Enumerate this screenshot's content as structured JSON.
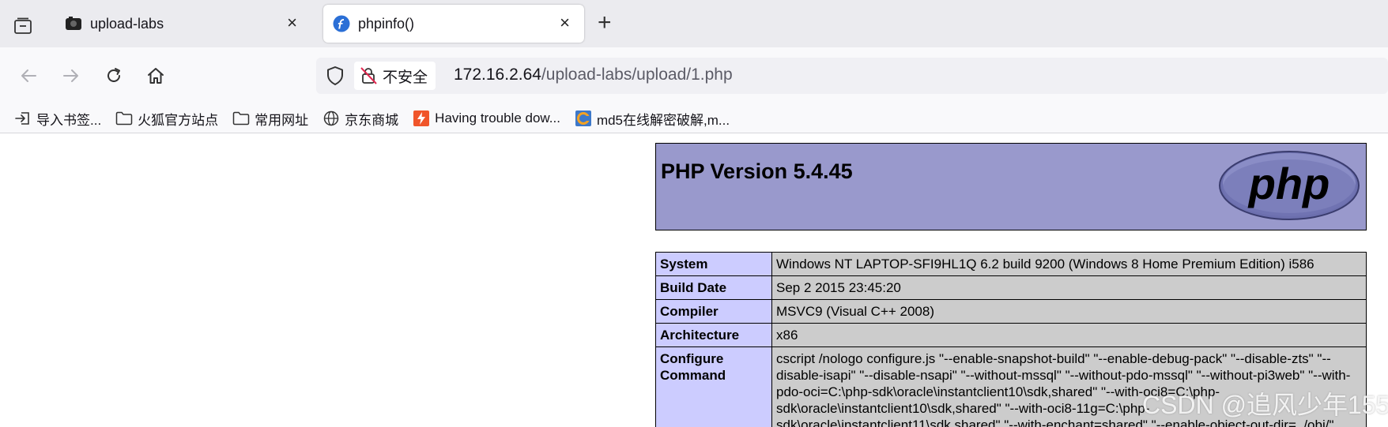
{
  "tabs": [
    {
      "title": "upload-labs",
      "active": false,
      "close": "×"
    },
    {
      "title": "phpinfo()",
      "active": true,
      "close": "×"
    }
  ],
  "new_tab_label": "+",
  "address": {
    "security_label": "不安全",
    "url_host": "172.16.2.64",
    "url_path": "/upload-labs/upload/1.php"
  },
  "bookmarks": [
    {
      "label": "导入书签...",
      "icon": "import-icon"
    },
    {
      "label": "火狐官方站点",
      "icon": "folder-icon"
    },
    {
      "label": "常用网址",
      "icon": "folder-icon"
    },
    {
      "label": "京东商城",
      "icon": "globe-icon"
    },
    {
      "label": "Having trouble dow...",
      "icon": "bolt-favicon"
    },
    {
      "label": "md5在线解密破解,m...",
      "icon": "cmd5-favicon"
    }
  ],
  "page": {
    "title": "PHP Version 5.4.45",
    "logo_text": "php",
    "rows": [
      {
        "key": "System",
        "value": "Windows NT LAPTOP-SFI9HL1Q 6.2 build 9200 (Windows 8 Home Premium Edition) i586"
      },
      {
        "key": "Build Date",
        "value": "Sep 2 2015 23:45:20"
      },
      {
        "key": "Compiler",
        "value": "MSVC9 (Visual C++ 2008)"
      },
      {
        "key": "Architecture",
        "value": "x86"
      },
      {
        "key": "Configure Command",
        "value": "cscript /nologo configure.js \"--enable-snapshot-build\" \"--enable-debug-pack\" \"--disable-zts\" \"--disable-isapi\" \"--disable-nsapi\" \"--without-mssql\" \"--without-pdo-mssql\" \"--without-pi3web\" \"--with-pdo-oci=C:\\php-sdk\\oracle\\instantclient10\\sdk,shared\" \"--with-oci8=C:\\php-sdk\\oracle\\instantclient10\\sdk,shared\" \"--with-oci8-11g=C:\\php-sdk\\oracle\\instantclient11\\sdk,shared\" \"--with-enchant=shared\" \"--enable-object-out-dir=../obj/\""
      }
    ]
  },
  "watermark": "CSDN @追风少年155",
  "colors": {
    "php_header": "#9999cc",
    "key_cell": "#ccccff",
    "value_cell": "#cccccc"
  }
}
